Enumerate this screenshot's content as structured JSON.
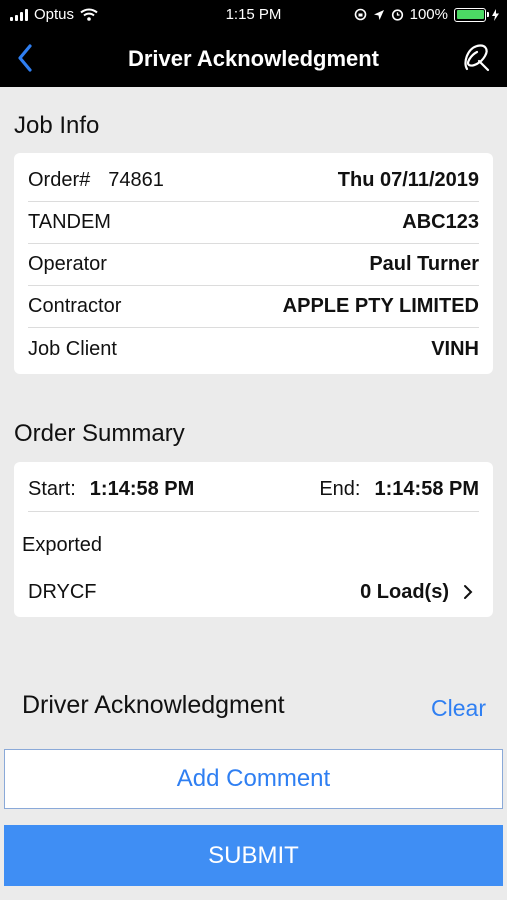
{
  "status_bar": {
    "carrier": "Optus",
    "time": "1:15 PM",
    "battery": "100%",
    "battery_color": "#4cd964"
  },
  "nav": {
    "title": "Driver Acknowledgment",
    "back_icon": "chevron-left-icon",
    "sign_icon": "signature-icon"
  },
  "job_info": {
    "heading": "Job Info",
    "order_label": "Order#",
    "order_number": "74861",
    "order_date": "Thu 07/11/2019",
    "rows": [
      {
        "label": "TANDEM",
        "value": "ABC123"
      },
      {
        "label": "Operator",
        "value": "Paul Turner"
      },
      {
        "label": "Contractor",
        "value": "APPLE PTY LIMITED"
      },
      {
        "label": "Job Client",
        "value": "VINH"
      }
    ]
  },
  "order_summary": {
    "heading": "Order Summary",
    "start_label": "Start:",
    "start_time": "1:14:58 PM",
    "end_label": "End:",
    "end_time": "1:14:58 PM",
    "exported_label": "Exported",
    "product": "DRYCF",
    "loads": "0 Load(s)"
  },
  "acknowledgment": {
    "heading": "Driver Acknowledgment",
    "clear_label": "Clear"
  },
  "actions": {
    "add_comment_label": "Add Comment",
    "submit_label": "SUBMIT"
  },
  "colors": {
    "accent": "#2f7ff2",
    "submit_bg": "#3f8ef4",
    "background": "#ebebeb"
  }
}
